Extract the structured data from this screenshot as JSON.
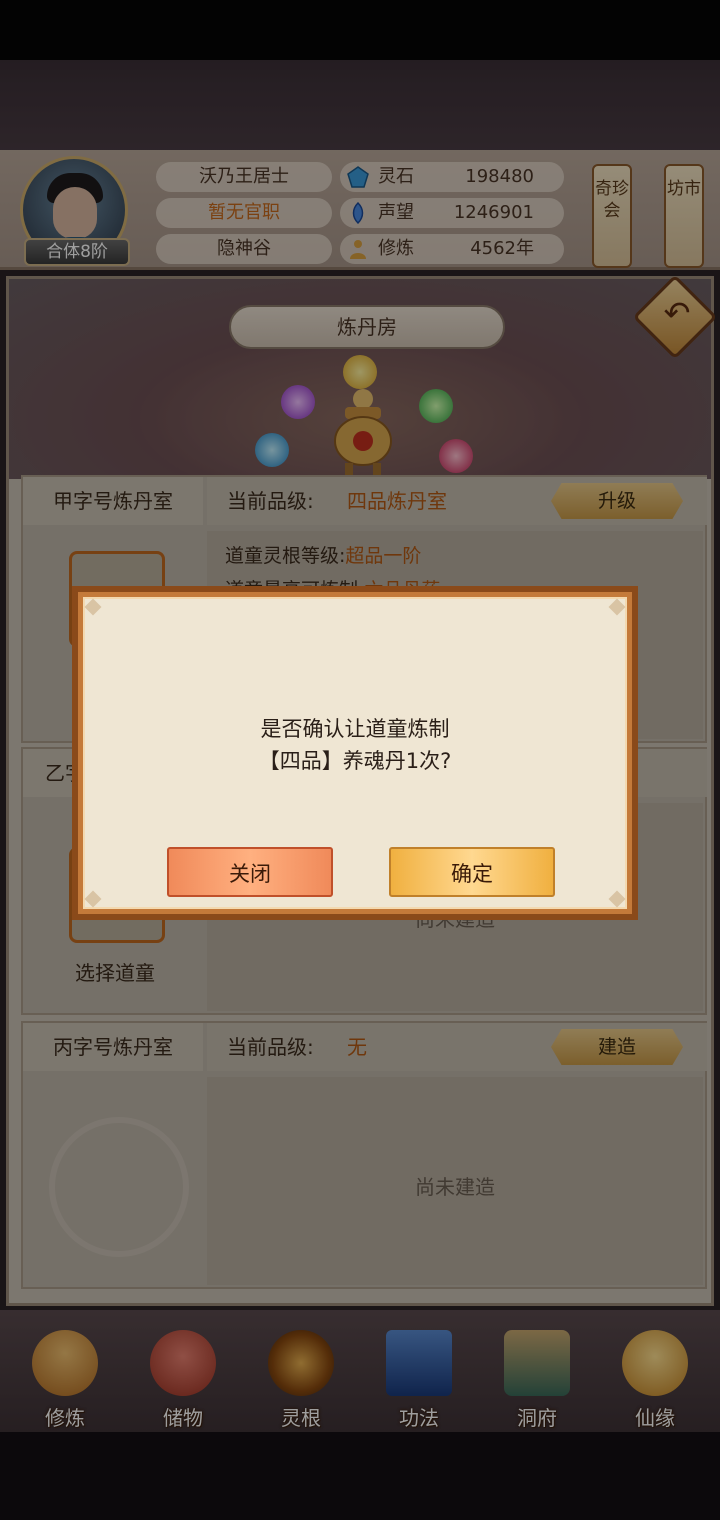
{
  "player": {
    "name": "沃乃王居士",
    "title": "暂无官职",
    "location": "隐神谷",
    "realm": "合体8阶"
  },
  "resources": [
    {
      "label": "灵石",
      "value": "198480",
      "icon": "spirit-stone-icon",
      "color": "#3a9ad9"
    },
    {
      "label": "声望",
      "value": "1246901",
      "icon": "reputation-icon",
      "color": "#4a8ae0"
    },
    {
      "label": "修炼",
      "value": "4562年",
      "icon": "cultivation-icon",
      "color": "#d9a040"
    }
  ],
  "header_buttons": {
    "treasure": "奇珍会",
    "market": "坊市"
  },
  "page": {
    "title": "炼丹房"
  },
  "rooms": [
    {
      "name": "甲字号炼丹室",
      "grade_label": "当前品级:",
      "grade_value": "四品炼丹室",
      "action": "升级",
      "details": [
        {
          "label": "道童灵根等级:",
          "value": "超品一阶"
        },
        {
          "label": "道童最高可炼制:",
          "value": "六品丹药"
        }
      ]
    },
    {
      "name": "乙字",
      "slot_caption": "选择道童",
      "status": "尚未建造"
    },
    {
      "name": "丙字号炼丹室",
      "grade_label": "当前品级:",
      "grade_value": "无",
      "action": "建造",
      "status": "尚未建造"
    }
  ],
  "bottom_nav": [
    {
      "label": "修炼",
      "icon": "cultivate-icon",
      "color": "#d9a050"
    },
    {
      "label": "储物",
      "icon": "storage-bag-icon",
      "color": "#c85a4a"
    },
    {
      "label": "灵根",
      "icon": "spirit-root-icon",
      "color": "#b8762a"
    },
    {
      "label": "功法",
      "icon": "manual-book-icon",
      "color": "#3a6ab0"
    },
    {
      "label": "洞府",
      "icon": "cave-dwelling-icon",
      "color": "#4a8a7a"
    },
    {
      "label": "仙缘",
      "icon": "immortal-fate-icon",
      "color": "#d9b040"
    }
  ],
  "dialog": {
    "line1": "是否确认让道童炼制",
    "line2": "【四品】养魂丹1次?",
    "close": "关闭",
    "confirm": "确定"
  }
}
